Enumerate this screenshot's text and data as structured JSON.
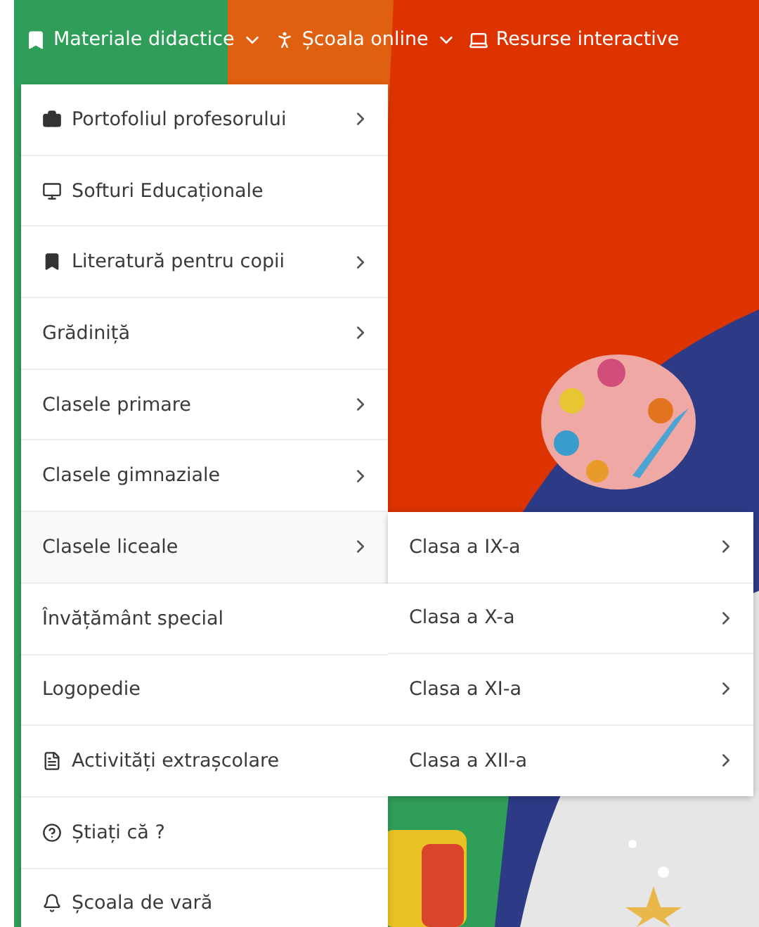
{
  "nav": [
    {
      "label": "Materiale didactice",
      "kind": "bookmark",
      "dropdown": true
    },
    {
      "label": "Școala online",
      "kind": "person",
      "dropdown": true
    },
    {
      "label": "Resurse interactive",
      "kind": "laptop",
      "dropdown": false
    }
  ],
  "menu": [
    {
      "label": "Portofoliul profesorului",
      "kind": "briefcase",
      "submenu": true,
      "expanded": false
    },
    {
      "label": "Softuri Educaționale",
      "kind": "monitor",
      "submenu": false
    },
    {
      "label": "Literatură pentru copii",
      "kind": "bookmark",
      "submenu": true,
      "expanded": false
    },
    {
      "label": "Grădiniță",
      "kind": "plain",
      "submenu": true,
      "expanded": false
    },
    {
      "label": "Clasele primare",
      "kind": "plain",
      "submenu": true,
      "expanded": false
    },
    {
      "label": "Clasele gimnaziale",
      "kind": "plain",
      "submenu": true,
      "expanded": false
    },
    {
      "label": "Clasele liceale",
      "kind": "plain",
      "submenu": true,
      "expanded": true,
      "children": [
        {
          "label": "Clasa a IX-a",
          "submenu": true
        },
        {
          "label": "Clasa a X-a",
          "submenu": true
        },
        {
          "label": "Clasa a XI-a",
          "submenu": true
        },
        {
          "label": "Clasa a XII-a",
          "submenu": true
        }
      ]
    },
    {
      "label": "Învățământ special",
      "kind": "plain",
      "submenu": false
    },
    {
      "label": "Logopedie",
      "kind": "plain",
      "submenu": false
    },
    {
      "label": "Activități extrașcolare",
      "kind": "document",
      "submenu": false
    },
    {
      "label": "Știați că ?",
      "kind": "question",
      "submenu": false
    },
    {
      "label": "Școala de vară",
      "kind": "bell",
      "submenu": false
    }
  ]
}
